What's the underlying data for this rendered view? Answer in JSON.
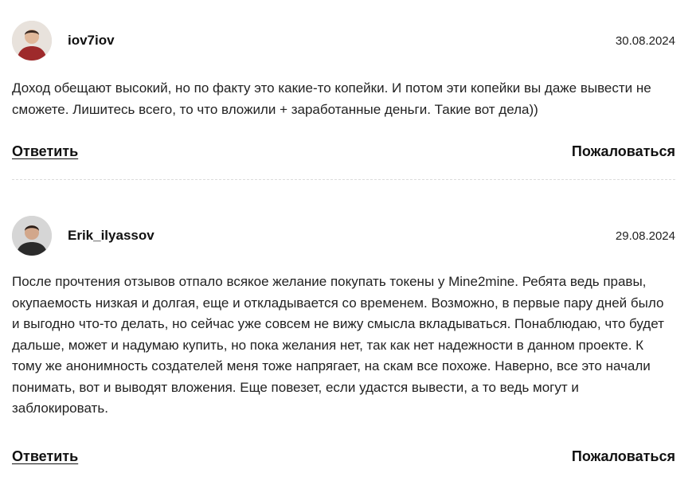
{
  "comments": [
    {
      "username": "iov7iov",
      "date": "30.08.2024",
      "text": "Доход обещают высокий, но по факту это какие-то копейки. И потом эти копейки вы даже вывести не сможете. Лишитесь всего, то что вложили + заработанные деньги. Такие вот дела))",
      "reply_label": "Ответить",
      "report_label": "Пожаловаться"
    },
    {
      "username": "Erik_ilyassov",
      "date": "29.08.2024",
      "text": "После прочтения отзывов отпало всякое желание покупать токены у Mine2mine. Ребята ведь правы, окупаемость низкая и долгая, еще и откладывается со временем. Возможно, в первые пару дней было и выгодно что-то делать, но сейчас уже совсем не вижу смысла вкладываться. Понаблюдаю, что будет дальше, может и надумаю купить, но пока желания нет, так как нет надежности в данном проекте. К тому же анонимность создателей меня тоже напрягает, на скам все похоже. Наверно, все это начали понимать, вот и выводят вложения. Еще повезет, если удастся вывести, а то ведь могут и заблокировать.",
      "reply_label": "Ответить",
      "report_label": "Пожаловаться"
    }
  ]
}
